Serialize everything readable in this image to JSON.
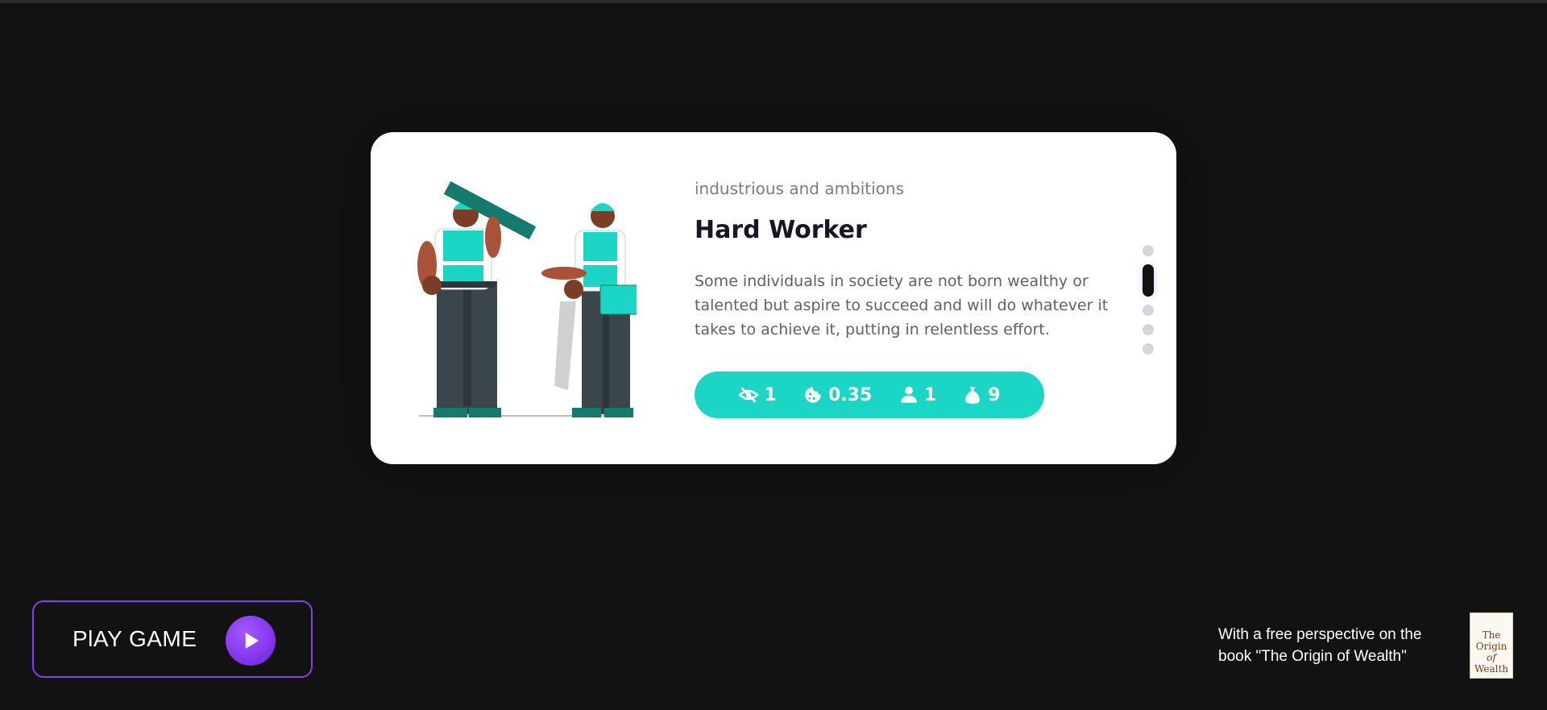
{
  "card": {
    "subtitle": "industrious and ambitions",
    "title": "Hard Worker",
    "description": "Some individuals in society are not born wealthy or talented but aspire to succeed and will do whatever it takes to achieve it, putting in relentless effort.",
    "stats": [
      {
        "icon": "eye-slash-icon",
        "value": "1"
      },
      {
        "icon": "cookie-icon",
        "value": "0.35"
      },
      {
        "icon": "person-icon",
        "value": "1"
      },
      {
        "icon": "money-bag-icon",
        "value": "9"
      }
    ],
    "accent_color": "#1bd6c4"
  },
  "pagination": {
    "count": 5,
    "active_index": 1
  },
  "play": {
    "label": "PlAY GAME",
    "accent_color": "#8a3cf0"
  },
  "book": {
    "text": "With a free perspective on the book \"The Origin of Wealth\"",
    "cover_title": "The Origin of Wealth"
  }
}
